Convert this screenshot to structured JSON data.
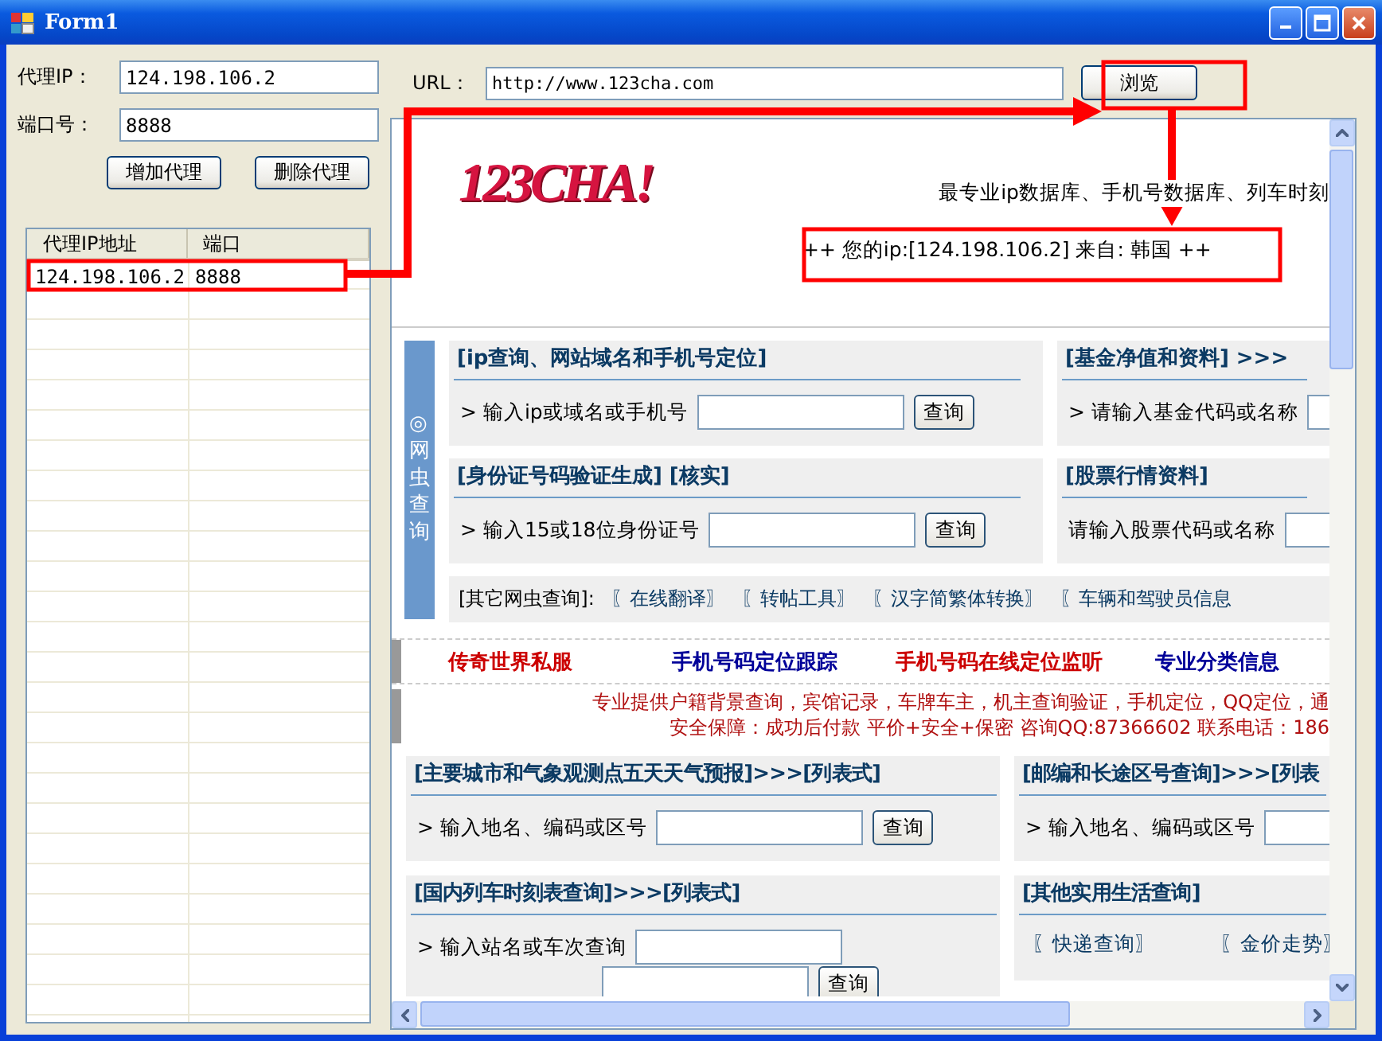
{
  "window": {
    "title": "Form1"
  },
  "proxy_form": {
    "ip_label": "代理IP：",
    "ip_value": "124.198.106.2",
    "port_label": "端口号：",
    "port_value": "8888",
    "buttons": [
      "增加代理",
      "删除代理"
    ]
  },
  "proxy_list": {
    "columns": [
      "代理IP地址",
      "端口"
    ],
    "rows": [
      {
        "ip": "124.198.106.2",
        "port": "8888"
      }
    ]
  },
  "url_bar": {
    "label": "URL：",
    "value": "http://www.123cha.com",
    "button": "浏览"
  },
  "page": {
    "logo": "123CHA!",
    "slogan": "最专业ip数据库、手机号数据库、列车时刻",
    "ip_banner": "++ 您的ip:[124.198.106.2] 来自: 韩国 ++",
    "side_tab": "◎网虫查询",
    "query_cards": [
      {
        "kind": "search",
        "title": "[ip查询、网站域名和手机号定位]",
        "prompt": "> 输入ip或域名或手机号",
        "button": "查询"
      },
      {
        "kind": "search",
        "title": "[基金净值和资料] >>>",
        "prompt": "> 请输入基金代码或名称"
      },
      {
        "kind": "search",
        "title": "[身份证号码验证生成] [核实]",
        "prompt": "> 输入15或18位身份证号",
        "button": "查询"
      },
      {
        "kind": "search",
        "title": "[股票行情资料]",
        "prompt": "请输入股票代码或名称"
      }
    ],
    "other_queries": {
      "label": "[其它网虫查询]:",
      "links": [
        "〖在线翻译〗",
        "〖转帖工具〗",
        "〖汉字简繁体转换〗",
        "〖车辆和驾驶员信息"
      ]
    },
    "ad_links": [
      {
        "text": "传奇世界私服",
        "color": "#cc0000"
      },
      {
        "text": "手机号码定位跟踪",
        "color": "#000099"
      },
      {
        "text": "手机号码在线定位监听",
        "color": "#cc0000"
      },
      {
        "text": "专业分类信息",
        "color": "#000099"
      }
    ],
    "ad_notice": [
      "专业提供户籍背景查询，宾馆记录，车牌车主，机主查询验证，手机定位，QQ定位，通",
      "安全保障：成功后付款 平价+安全+保密 咨询QQ:87366602 联系电话：186"
    ],
    "life_cards": [
      {
        "kind": "search",
        "title": "[主要城市和气象观测点五天天气预报]>>>[列表式]",
        "prompt": "> 输入地名、编码或区号",
        "button": "查询"
      },
      {
        "kind": "search",
        "title": "[邮编和长途区号查询]>>>[列表",
        "prompt": "> 输入地名、编码或区号"
      },
      {
        "kind": "train",
        "title": "[国内列车时刻表查询]>>>[列表式]",
        "prompt": "> 输入站名或车次查询",
        "button": "查询"
      },
      {
        "kind": "links",
        "title": "[其他实用生活查询]",
        "links": [
          "〖快递查询〗",
          "〖金价走势〗"
        ]
      }
    ]
  }
}
